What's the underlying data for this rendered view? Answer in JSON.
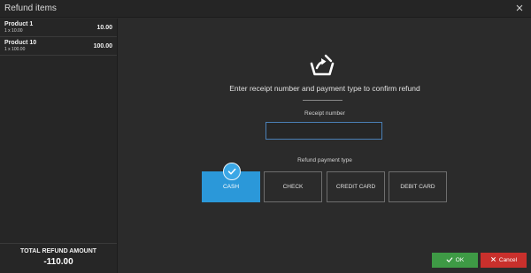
{
  "window": {
    "title": "Refund items"
  },
  "items": [
    {
      "name": "Product 1",
      "qty": "1 x 10.00",
      "total": "10.00"
    },
    {
      "name": "Product 10",
      "qty": "1 x 100.00",
      "total": "100.00"
    }
  ],
  "summary": {
    "label": "TOTAL REFUND AMOUNT",
    "value": "-110.00"
  },
  "main": {
    "instruction": "Enter receipt number and payment type to confirm refund",
    "receipt_label": "Receipt number",
    "receipt_value": "",
    "payment_label": "Refund payment type",
    "payment_types": [
      "CASH",
      "CHECK",
      "CREDIT CARD",
      "DEBIT CARD"
    ],
    "selected_payment": "CASH"
  },
  "actions": {
    "ok": "OK",
    "cancel": "Cancel"
  },
  "colors": {
    "accent": "#2b98d9",
    "ok": "#3e9a45",
    "cancel": "#c9302c"
  },
  "icons": {
    "close": "close-icon",
    "basket": "refund-basket-icon",
    "check": "checkmark-icon"
  }
}
